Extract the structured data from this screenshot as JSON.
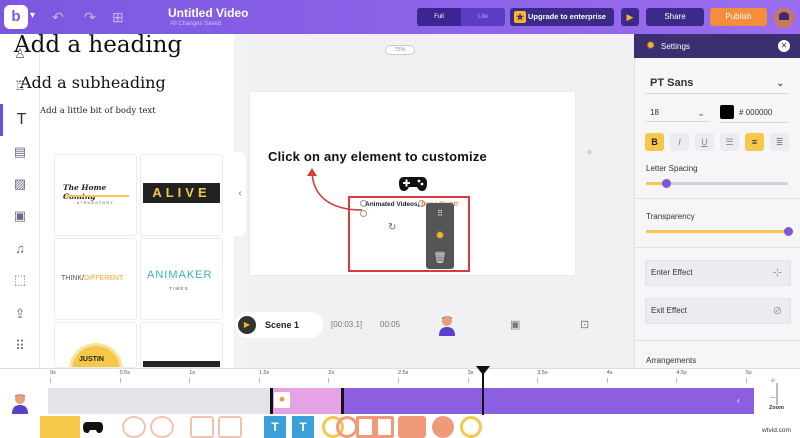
{
  "header": {
    "title": "Untitled Video",
    "subtitle": "All Changes Saved",
    "mode_full": "Full",
    "mode_lite": "Lite",
    "upgrade_label": "Upgrade to enterprise",
    "share_label": "Share",
    "publish_label": "Publish",
    "accent": "#7b57e0",
    "publish_color": "#f58e3a"
  },
  "sidebar": {
    "items": [
      {
        "icon": "character-icon"
      },
      {
        "icon": "props-icon"
      },
      {
        "icon": "text-icon",
        "active": true
      },
      {
        "icon": "background-icon"
      },
      {
        "icon": "image-icon"
      },
      {
        "icon": "video-icon"
      },
      {
        "icon": "music-icon"
      },
      {
        "icon": "effects-icon"
      },
      {
        "icon": "upload-icon"
      },
      {
        "icon": "more-icon"
      }
    ]
  },
  "text_panel": {
    "heading": "Add a heading",
    "subheading": "Add a subheading",
    "body": "Add a little bit of body text",
    "templates": [
      {
        "line1": "The Home Coming",
        "line2": "#TRUESTORY"
      },
      {
        "line1": "ALIVE"
      },
      {
        "line1": "THINK/",
        "line2": "DIFFERENT"
      },
      {
        "line1": "ANIMAKER",
        "line2": "T I M E S"
      },
      {
        "line1": "JUSTIN"
      },
      {
        "line1": ""
      }
    ]
  },
  "canvas": {
    "zoom": "75%",
    "headline": "Click on any element to customize",
    "selected_text": "Animated Videos,",
    "selected_text_highlight": "Done Right!"
  },
  "scene": {
    "name": "Scene 1",
    "duration_total": "[00:03.1]",
    "duration_scene": "00:05"
  },
  "settings": {
    "title": "Settings",
    "font": "PT Sans",
    "size": "18",
    "color_hex": "# 000000",
    "bold": "B",
    "italic": "I",
    "underline": "U",
    "letter_spacing_label": "Letter Spacing",
    "letter_spacing_value": 0.14,
    "transparency_label": "Transparency",
    "transparency_value": 1.0,
    "enter_effect": "Enter Effect",
    "exit_effect": "Exit Effect",
    "arrangements": "Arrangements"
  },
  "timeline": {
    "ticks": [
      "0s",
      "0.5s",
      "1s",
      "1.5s",
      "2s",
      "2.5s",
      "3s",
      "3.5s",
      "4s",
      "4.5s",
      "5s"
    ],
    "zoom_label": "Zoom",
    "watermark": "wtvid.com"
  }
}
